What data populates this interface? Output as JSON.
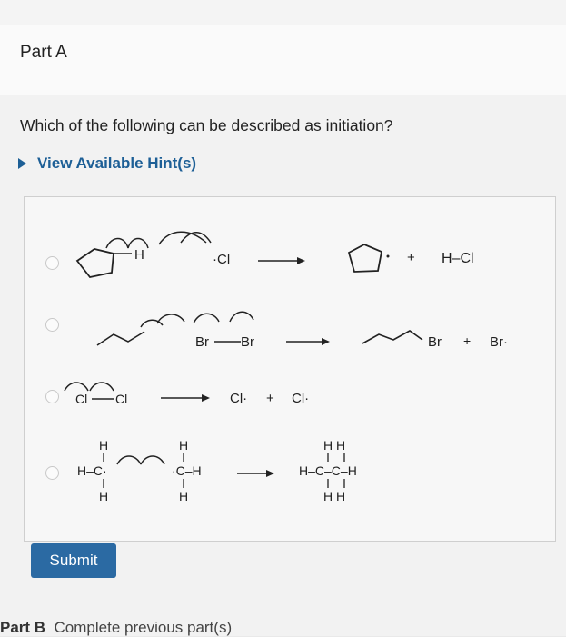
{
  "part_a": {
    "title": "Part A"
  },
  "question": {
    "text": "Which of the following can be described as initiation?"
  },
  "hint": {
    "label": "View Available Hint(s)"
  },
  "options": [
    {
      "products": [
        "H–Cl"
      ],
      "plus": "+",
      "radical_label": "·Cl",
      "h_label": "H"
    },
    {
      "reactant": [
        "Br",
        "Br"
      ],
      "products": [
        "Br",
        "Br·"
      ],
      "plus": "+"
    },
    {
      "reactant": [
        "Cl",
        "Cl"
      ],
      "products": [
        "Cl·",
        "Cl·"
      ],
      "plus": "+"
    },
    {
      "left_struct": [
        "H",
        "H–C·",
        "H"
      ],
      "right_struct": [
        "H",
        "·C–H",
        "H"
      ],
      "product": [
        "H H",
        "H–C–C–H",
        "H H"
      ]
    }
  ],
  "submit": {
    "label": "Submit"
  },
  "part_b": {
    "label": "Part B",
    "text": "Complete previous part(s)"
  }
}
